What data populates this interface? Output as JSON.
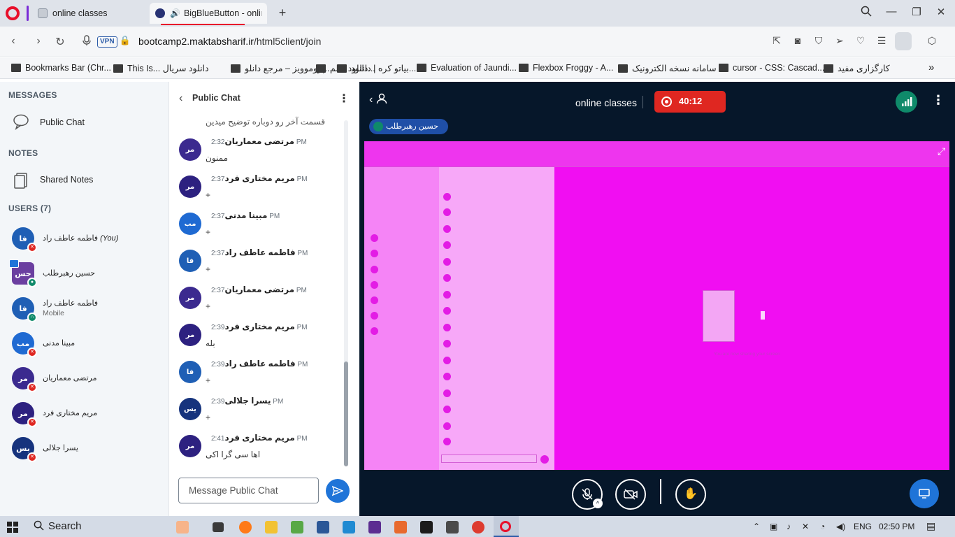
{
  "browser": {
    "tabs": [
      {
        "title": "online classes"
      },
      {
        "title": "BigBlueButton - online"
      }
    ],
    "new_tab": "+",
    "vpn": "VPN",
    "url_host": "bootcamp2.maktabsharif.ir",
    "url_path": "/html5client/join",
    "bookmarks": [
      "Bookmarks Bar (Chr...",
      "This Is... دانلود سریال",
      "پروموویز – مرجع دانلو...",
      "دانلود فیلم...",
      "بیاتو کره | دانلود...",
      "Evaluation of Jaundi...",
      "Flexbox Froggy - A...",
      "سامانه نسخه الکترونیک",
      "cursor - CSS: Cascad...",
      "کارگزاری مفید"
    ],
    "bookmarks_more": "»"
  },
  "sidebar": {
    "messages_title": "MESSAGES",
    "public_chat": "Public Chat",
    "notes_title": "NOTES",
    "shared_notes": "Shared Notes",
    "users_title": "USERS (7)",
    "users": [
      {
        "initials": "فا",
        "name": "فاطمه عاطف راد",
        "you": "(You)",
        "sub": "",
        "color": "#1f5fb5"
      },
      {
        "initials": "حس",
        "name": "حسین رهبرطلب",
        "you": "",
        "sub": "",
        "color": "#6b3fa0"
      },
      {
        "initials": "فا",
        "name": "فاطمه عاطف راد",
        "you": "",
        "sub": "Mobile",
        "color": "#1f5fb5"
      },
      {
        "initials": "مب",
        "name": "مبینا مدنی",
        "you": "",
        "sub": "",
        "color": "#1f6ad2"
      },
      {
        "initials": "مر",
        "name": "مرتضی معماریان",
        "you": "",
        "sub": "",
        "color": "#3b2a8f"
      },
      {
        "initials": "مر",
        "name": "مریم مختاری فرد",
        "you": "",
        "sub": "",
        "color": "#2d2180"
      },
      {
        "initials": "یس",
        "name": "یسرا جلالی",
        "you": "",
        "sub": "",
        "color": "#16337d"
      }
    ]
  },
  "chat": {
    "back": "‹",
    "title": "Public Chat",
    "kebab": "⋮",
    "partial_text": "قسمت آخر رو دوباره توضیح میدین",
    "messages": [
      {
        "initials": "مر",
        "name": "مرتضی معماریان",
        "time": "2:32 PM",
        "text": "ممنون",
        "color": "#3b2a8f"
      },
      {
        "initials": "مر",
        "name": "مریم مختاری فرد",
        "time": "2:37 PM",
        "text": "+",
        "color": "#2d2180"
      },
      {
        "initials": "مب",
        "name": "مبینا مدنی",
        "time": "2:37 PM",
        "text": "+",
        "color": "#1f6ad2"
      },
      {
        "initials": "فا",
        "name": "فاطمه عاطف راد",
        "time": "2:37 PM",
        "text": "+",
        "color": "#1f5fb5"
      },
      {
        "initials": "مر",
        "name": "مرتضی معماریان",
        "time": "2:37 PM",
        "text": "+",
        "color": "#3b2a8f"
      },
      {
        "initials": "مر",
        "name": "مریم مختاری فرد",
        "time": "2:39 PM",
        "text": "بله",
        "color": "#2d2180"
      },
      {
        "initials": "فا",
        "name": "فاطمه عاطف راد",
        "time": "2:39 PM",
        "text": "+",
        "color": "#1f5fb5"
      },
      {
        "initials": "یس",
        "name": "یسرا جلالی",
        "time": "2:39 PM",
        "text": "+",
        "color": "#16337d"
      },
      {
        "initials": "مر",
        "name": "مریم مختاری فرد",
        "time": "2:41 PM",
        "text": "اها سی گرا اکی",
        "color": "#2d2180"
      }
    ],
    "input_placeholder": "Message Public Chat"
  },
  "meeting": {
    "title": "online classes",
    "recording_time": "40:12",
    "talker": "حسین رهبرطلب",
    "screen_text": "You are now sharing your screen",
    "recording_color": "#df2721",
    "connection_color": "#0f8a6a"
  },
  "taskbar": {
    "search": "Search",
    "language": "ENG",
    "time": "02:50 PM"
  }
}
